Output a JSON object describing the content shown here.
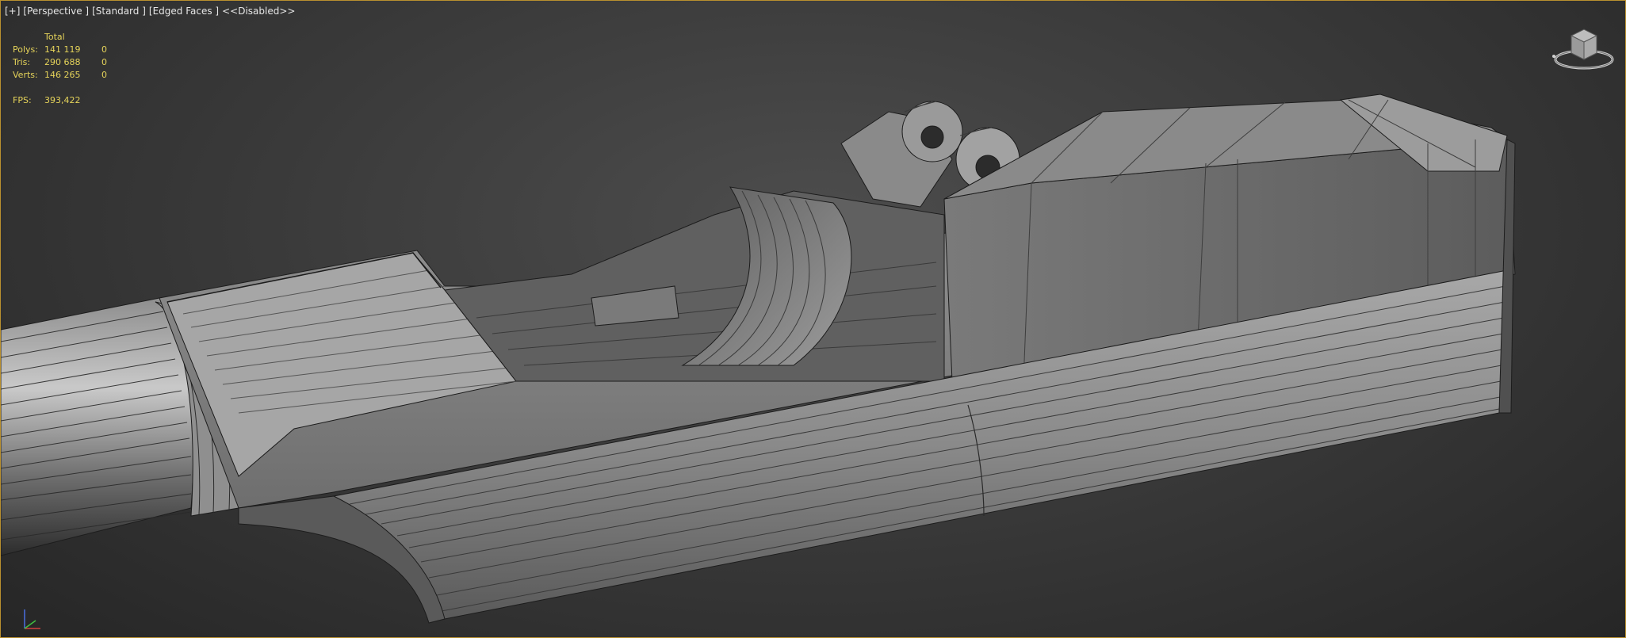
{
  "viewport": {
    "label_parts": [
      "[+]",
      "[Perspective ]",
      "[Standard ]",
      "[Edged Faces ]",
      "<<Disabled>>"
    ]
  },
  "stats": {
    "header": "Total",
    "rows": [
      {
        "label": "Polys:",
        "total": "141 119",
        "selected": "0"
      },
      {
        "label": "Tris:",
        "total": "290 688",
        "selected": "0"
      },
      {
        "label": "Verts:",
        "total": "146 265",
        "selected": "0"
      }
    ],
    "fps_label": "FPS:",
    "fps_value": "393,422"
  },
  "colors": {
    "frame_border": "#b9902f",
    "stats_text": "#e5d35a",
    "label_text": "#e6e6e6"
  },
  "icons": {
    "viewcube": "viewcube-icon",
    "axis": "axis-tripod-icon"
  }
}
